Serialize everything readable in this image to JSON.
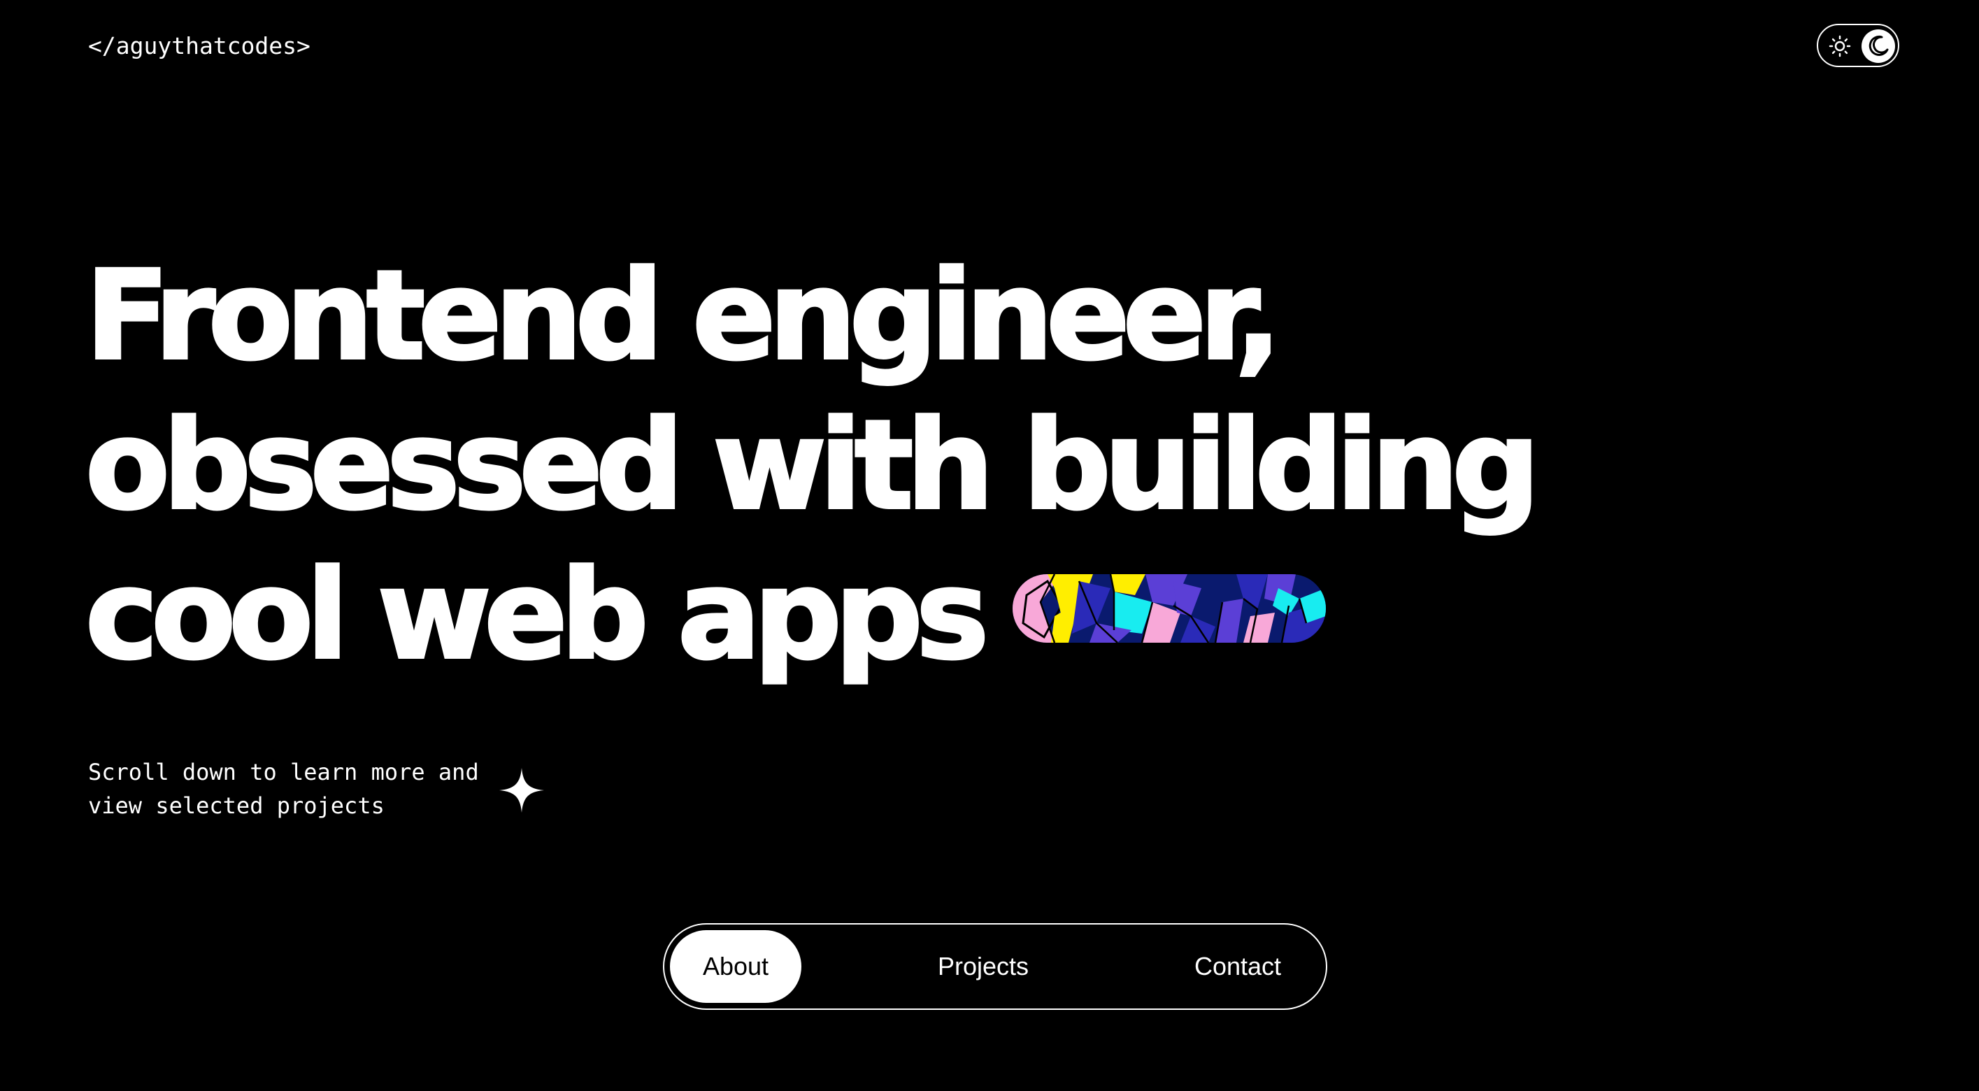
{
  "header": {
    "logo_text": "</aguythatcodes>",
    "theme_toggle": {
      "light_icon": "sun-icon",
      "dark_icon": "moon-icon",
      "selected": "dark"
    }
  },
  "hero": {
    "headline_lines": [
      "Frontend engineer,",
      "obsessed with building",
      "cool web apps"
    ],
    "decorative_image": "abstract-geometric-pill-art"
  },
  "scroll_hint": {
    "lines": [
      "Scroll down to learn more and",
      "view selected projects"
    ],
    "icon": "sparkle-icon"
  },
  "nav": {
    "items": [
      {
        "label": "About",
        "active": true
      },
      {
        "label": "Projects",
        "active": false
      },
      {
        "label": "Contact",
        "active": false
      }
    ]
  },
  "colors": {
    "background": "#000000",
    "foreground": "#ffffff",
    "art_palette": [
      "#f8a8d8",
      "#ffee00",
      "#18ecf0",
      "#5b3fd6",
      "#0a1a6e",
      "#2a2ab8"
    ]
  }
}
